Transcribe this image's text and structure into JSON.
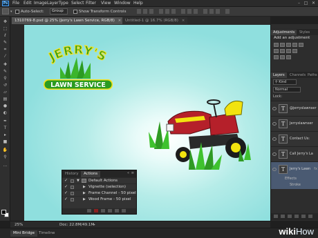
{
  "app": {
    "logo_text": "Ps"
  },
  "menu": [
    "File",
    "Edit",
    "Image",
    "Layer",
    "Type",
    "Select",
    "Filter",
    "View",
    "Window",
    "Help"
  ],
  "options_bar": {
    "auto_select_label": "Auto-Select:",
    "auto_select_value": "Group",
    "show_transform_label": "Show Transform Controls"
  },
  "tabs": [
    {
      "label": "1310769-8.psd @ 25% (Jerry's Lawn  Service, RGB/8)",
      "active": true
    },
    {
      "label": "Untitled-1 @ 16.7% (RGB/8)",
      "active": false
    }
  ],
  "canvas": {
    "logo_line1": "JERRY'S",
    "logo_line2": "LAWN SERVICE",
    "colors": {
      "logo_green": "#2b9b21",
      "logo_yellow": "#f7e21a",
      "mower_red": "#b5202a",
      "mower_seat": "#f2e30f"
    }
  },
  "panels": {
    "adjustments": {
      "tabs": [
        "Adjustments",
        "Styles"
      ],
      "title": "Add an adjustment"
    },
    "layers": {
      "tabs": [
        "Layers",
        "Channels",
        "Paths"
      ],
      "kind_filter": "Kind",
      "blend_mode": "Normal",
      "lock_label": "Lock:",
      "rows": [
        {
          "thumb": "T",
          "name": "@jerryslawnser",
          "selected": false,
          "fx": false
        },
        {
          "thumb": "T",
          "name": "Jerryslawnser",
          "selected": false,
          "fx": false
        },
        {
          "thumb": "T",
          "name": "Contact Us:",
          "selected": false,
          "fx": false
        },
        {
          "thumb": "T",
          "name": "Call Jerry's La",
          "selected": false,
          "fx": false
        },
        {
          "thumb": "T",
          "name": "Jerry's Lawn",
          "selected": true,
          "fx": true
        }
      ],
      "effects_label": "Effects",
      "stroke_label": "Stroke"
    },
    "actions": {
      "tabs": [
        {
          "label": "History",
          "active": false
        },
        {
          "label": "Actions",
          "active": true
        }
      ],
      "rows": [
        {
          "label": "Default Actions",
          "checked": true,
          "expanded": true,
          "indent": 0
        },
        {
          "label": "Vignette (selection)",
          "checked": true,
          "expanded": false,
          "indent": 1
        },
        {
          "label": "Frame Channel - 50 pixel",
          "checked": true,
          "expanded": false,
          "indent": 1
        },
        {
          "label": "Wood Frame - 50 pixel",
          "checked": true,
          "expanded": false,
          "indent": 1
        }
      ]
    }
  },
  "status": {
    "zoom": "25%",
    "doc_info": "Doc: 22.8M/49.1M"
  },
  "bottom_tabs": [
    "Mini Bridge",
    "Timeline"
  ],
  "watermark": {
    "wiki": "wiki",
    "how": "How"
  }
}
